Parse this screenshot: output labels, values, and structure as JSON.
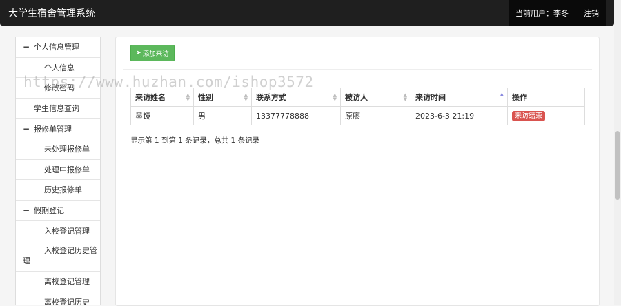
{
  "header": {
    "title": "大学生宿舍管理系统",
    "current_user_label": "当前用户：",
    "current_user": "李冬",
    "logout": "注销"
  },
  "sidebar": {
    "personal_group": "个人信息管理",
    "personal_info": "个人信息",
    "change_password": "修改密码",
    "student_query": "学生信息查询",
    "repair_group": "报修单管理",
    "repair_pending": "未处理报修单",
    "repair_processing": "处理中报修单",
    "repair_history": "历史报修单",
    "holiday_group": "假期登记",
    "return_manage": "入校登记管理",
    "return_history": "入校登记历史管理",
    "leave_manage": "离校登记管理",
    "leave_history": "离校登记历史"
  },
  "toolbar": {
    "add_visit": "添加来访"
  },
  "table": {
    "columns": [
      "来访姓名",
      "性别",
      "联系方式",
      "被访人",
      "来访时间",
      "操作"
    ],
    "rows": [
      {
        "name": "墨镜",
        "gender": "男",
        "phone": "13377778888",
        "host": "原廖",
        "time": "2023-6-3 21:19",
        "action": "来访结束"
      }
    ]
  },
  "summary": "显示第 1 到第 1 条记录，总共 1 条记录",
  "watermark": "https://www.huzhan.com/ishop3572",
  "colors": {
    "primary_green": "#5cb85c",
    "danger_red": "#d9534f",
    "header_bg": "#1f1f1f"
  }
}
